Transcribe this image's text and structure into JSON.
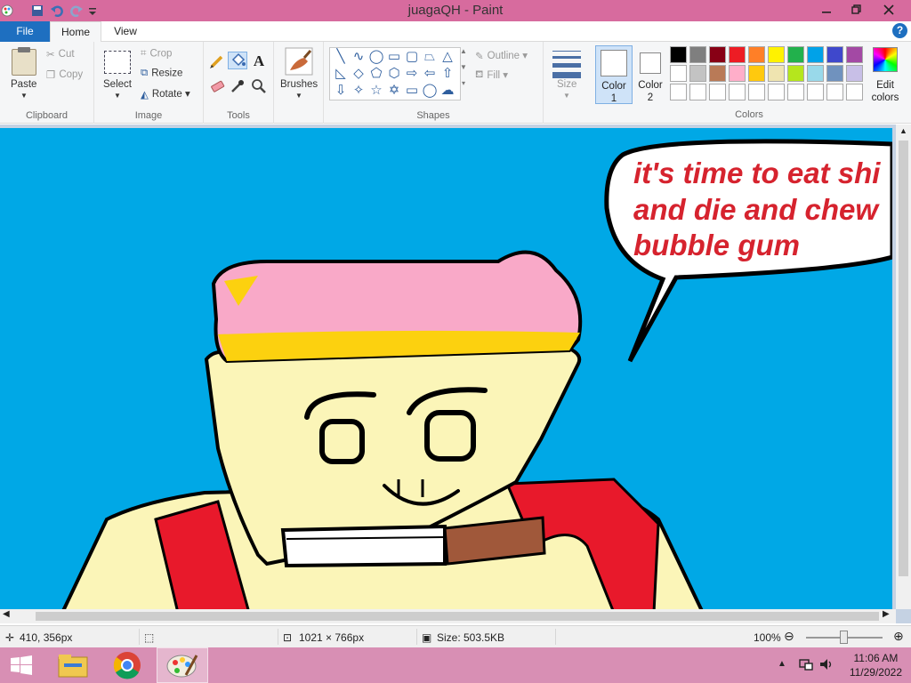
{
  "window": {
    "title": "juagaQH - Paint",
    "controls": [
      "minimize",
      "restore",
      "close"
    ]
  },
  "quick_access": [
    "paint-app-icon",
    "save-icon",
    "undo-icon",
    "redo-icon",
    "customize-icon"
  ],
  "tabs": {
    "file": "File",
    "home": "Home",
    "view": "View"
  },
  "ribbon": {
    "clipboard": {
      "label": "Clipboard",
      "paste": "Paste",
      "cut": "Cut",
      "copy": "Copy"
    },
    "image": {
      "label": "Image",
      "select": "Select",
      "crop": "Crop",
      "resize": "Resize",
      "rotate": "Rotate"
    },
    "tools": {
      "label": "Tools",
      "text_tool_glyph": "A"
    },
    "brushes": {
      "label": "Brushes"
    },
    "shapes": {
      "label": "Shapes",
      "outline": "Outline",
      "fill": "Fill"
    },
    "size": {
      "label": "Size"
    },
    "colors": {
      "label": "Colors",
      "color1_line1": "Color",
      "color1_line2": "1",
      "color2_line1": "Color",
      "color2_line2": "2",
      "edit_line1": "Edit",
      "edit_line2": "colors",
      "palette_row1": [
        "#000000",
        "#7f7f7f",
        "#880015",
        "#ed1c24",
        "#ff7f27",
        "#fff200",
        "#22b14c",
        "#00a2e8",
        "#3f48cc",
        "#a349a4"
      ],
      "palette_row2": [
        "#ffffff",
        "#c3c3c3",
        "#b97a57",
        "#ffaec9",
        "#ffc90e",
        "#efe4b0",
        "#b5e61d",
        "#99d9ea",
        "#7092be",
        "#c8bfe7"
      ],
      "palette_row3": [
        "#ffffff",
        "#ffffff",
        "#ffffff",
        "#ffffff",
        "#ffffff",
        "#ffffff",
        "#ffffff",
        "#ffffff",
        "#ffffff",
        "#ffffff"
      ]
    }
  },
  "canvas": {
    "background": "#00a8e6",
    "speech_lines": [
      "it's time to eat shi",
      "and die and chew",
      "bubble gum"
    ]
  },
  "status": {
    "cursor_position": "410, 356px",
    "canvas_size": "1021 × 766px",
    "file_size": "Size: 503.5KB",
    "zoom": "100%"
  },
  "taskbar": {
    "apps": [
      "file-explorer-icon",
      "chrome-icon",
      "paint-icon"
    ],
    "time": "11:06 AM",
    "date": "11/29/2022"
  }
}
